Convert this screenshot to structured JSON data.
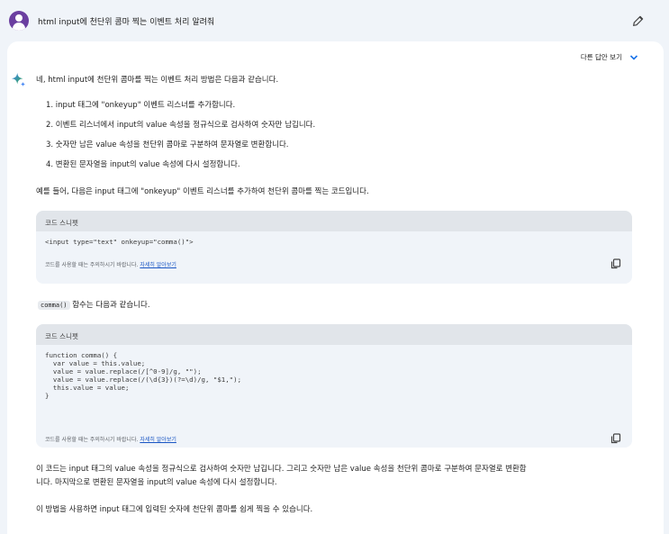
{
  "prompt": {
    "text": "html input에 천단위 콤마 찍는 이벤트 처리 알려줘"
  },
  "response": {
    "drafts_label": "다른 답안 보기",
    "intro": "네, html input에 천단위 콤마를 찍는 이벤트 처리 방법은 다음과 같습니다.",
    "steps": [
      "1. input 태그에 \"onkeyup\" 이벤트 리스너를 추가합니다.",
      "2. 이벤트 리스너에서 input의 value 속성을 정규식으로 검사하여 숫자만 남깁니다.",
      "3. 숫자만 남은 value 속성을 천단위 콤마로 구분하여 문자열로 변환합니다.",
      "4. 변환된 문자열을 input의 value 속성에 다시 설정합니다."
    ],
    "example_intro": "예를 들어, 다음은 input 태그에 \"onkeyup\" 이벤트 리스너를 추가하여 천단위 콤마를 찍는 코드입니다.",
    "code1": {
      "header": "코드 스니펫",
      "code": "<input type=\"text\" onkeyup=\"comma()\">",
      "footer_text": "코드를 사용할 때는 주의하시기 바랍니다.",
      "footer_link": "자세히 알아보기"
    },
    "func_inline": "comma()",
    "func_text": " 함수는 다음과 같습니다.",
    "code2": {
      "header": "코드 스니펫",
      "code": "function comma() {\n  var value = this.value;\n  value = value.replace(/[^0-9]/g, \"\");\n  value = value.replace(/(\\d{3})(?=\\d)/g, \"$1,\");\n  this.value = value;\n}",
      "footer_text": "코드를 사용할 때는 주의하시기 바랍니다.",
      "footer_link": "자세히 알아보기"
    },
    "explain_line1": "이 코드는 input 태그의 value 속성을 정규식으로 검사하여 숫자만 남깁니다. 그리고 숫자만 남은 value 속성을 천단위 콤마로 구분하여 문자열로 변환합",
    "explain_line2": "니다. 마지막으로 변환된 문자열을 input의 value 속성에 다시 설정합니다.",
    "conclusion": "이 방법을 사용하면 input 태그에 입력된 숫자에 천단위 콤마를 쉽게 찍을 수 있습니다."
  },
  "colors": {
    "accent": "#1a73e8",
    "avatar": "#6b3fa0",
    "background": "#f0f4f9"
  },
  "icons": [
    "user-avatar-icon",
    "edit-pencil-icon",
    "chevron-down-icon",
    "gemini-sparkle-icon",
    "copy-icon"
  ]
}
